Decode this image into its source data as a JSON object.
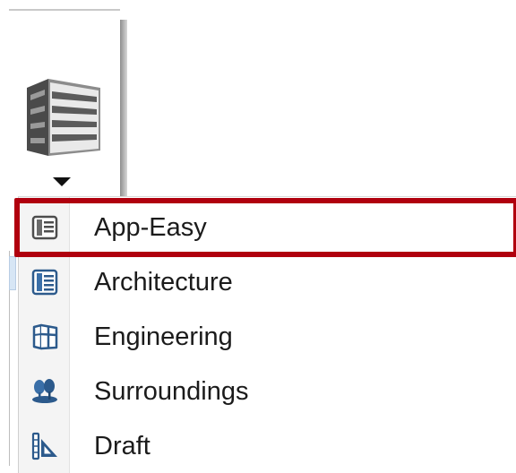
{
  "ribbon": {
    "button_icon": "building-icon",
    "dropdown_icon": "caret-down-icon"
  },
  "menu": {
    "items": [
      {
        "label": "App-Easy",
        "icon": "building-gray-icon"
      },
      {
        "label": "Architecture",
        "icon": "building-blue-icon"
      },
      {
        "label": "Engineering",
        "icon": "structure-frame-icon"
      },
      {
        "label": "Surroundings",
        "icon": "trees-icon"
      },
      {
        "label": "Draft",
        "icon": "drafting-triangle-icon"
      }
    ],
    "selected_index": 0,
    "highlight_color": "#b0000e"
  }
}
